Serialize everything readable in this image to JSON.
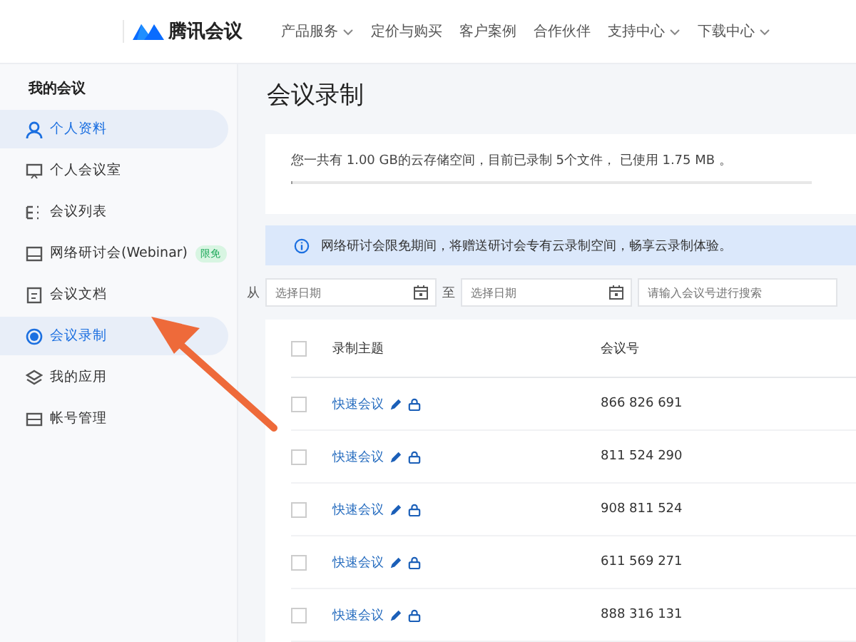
{
  "header": {
    "brand": "腾讯会议",
    "nav": [
      {
        "label": "产品服务",
        "dropdown": true
      },
      {
        "label": "定价与购买",
        "dropdown": false
      },
      {
        "label": "客户案例",
        "dropdown": false
      },
      {
        "label": "合作伙伴",
        "dropdown": false
      },
      {
        "label": "支持中心",
        "dropdown": true
      },
      {
        "label": "下载中心",
        "dropdown": true
      }
    ]
  },
  "sidebar": {
    "heading": "我的会议",
    "items": [
      {
        "label": "个人资料",
        "kind": "user",
        "selected": true
      },
      {
        "label": "个人会议室",
        "kind": "room",
        "selected": false
      },
      {
        "label": "会议列表",
        "kind": "list",
        "selected": false
      },
      {
        "label": "网络研讨会(Webinar)",
        "kind": "webinar",
        "badge": "限免",
        "selected": false
      },
      {
        "label": "会议文档",
        "kind": "doc",
        "selected": false
      },
      {
        "label": "会议录制",
        "kind": "record",
        "selected": true
      },
      {
        "label": "我的应用",
        "kind": "apps",
        "selected": false
      },
      {
        "label": "帐号管理",
        "kind": "account",
        "selected": false
      }
    ]
  },
  "page_title": "会议录制",
  "storage": {
    "text": "您一共有 1.00 GB的云存储空间，目前已录制 5个文件， 已使用 1.75 MB 。",
    "level": 0.002
  },
  "notice": "网络研讨会限免期间，将赠送研讨会专有云录制空间，畅享云录制体验。",
  "filter": {
    "from_label": "从",
    "from_placeholder": "选择日期",
    "to_label": "至",
    "to_placeholder": "选择日期",
    "search_placeholder": "请输入会议号进行搜索"
  },
  "table": {
    "columns": [
      "录制主题",
      "会议号"
    ],
    "all_checked": false,
    "rows": [
      {
        "topic": "快速会议",
        "meeting_id": "866 826 691",
        "checked": false
      },
      {
        "topic": "快速会议",
        "meeting_id": "811 524 290",
        "checked": false
      },
      {
        "topic": "快速会议",
        "meeting_id": "908 811 524",
        "checked": false
      },
      {
        "topic": "快速会议",
        "meeting_id": "611 569 271",
        "checked": false
      },
      {
        "topic": "快速会议",
        "meeting_id": "888 316 131",
        "checked": false
      }
    ]
  }
}
